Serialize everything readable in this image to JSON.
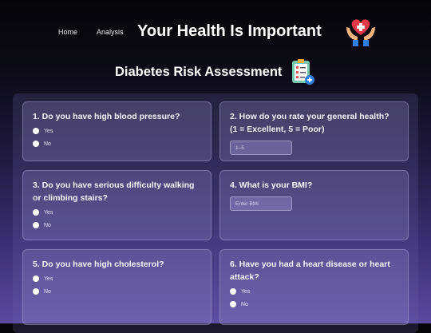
{
  "nav": {
    "home": "Home",
    "analysis": "Analysis"
  },
  "site_title": "Your Health Is Important",
  "page_title": "Diabetes Risk Assessment",
  "icons": {
    "hero": "hands-heart-icon",
    "form": "clipboard-checklist-icon"
  },
  "colors": {
    "heart": "#e53945",
    "hands": "#f4b27a",
    "cuff": "#2f7de1"
  },
  "questions": [
    {
      "label": "1. Do you have high blood pressure?",
      "options": [
        "Yes",
        "No"
      ]
    },
    {
      "label": "2. How do you rate your general health? (1 = Excellent, 5 = Poor)",
      "placeholder": "1–5"
    },
    {
      "label": "3. Do you have serious difficulty walking or climbing stairs?",
      "options": [
        "Yes",
        "No"
      ]
    },
    {
      "label": "4. What is your BMI?",
      "placeholder": "Enter BMI"
    },
    {
      "label": "5. Do you have high cholesterol?",
      "options": [
        "Yes",
        "No"
      ]
    },
    {
      "label": "6. Have you had a heart disease or heart attack?",
      "options": [
        "Yes",
        "No"
      ]
    }
  ]
}
